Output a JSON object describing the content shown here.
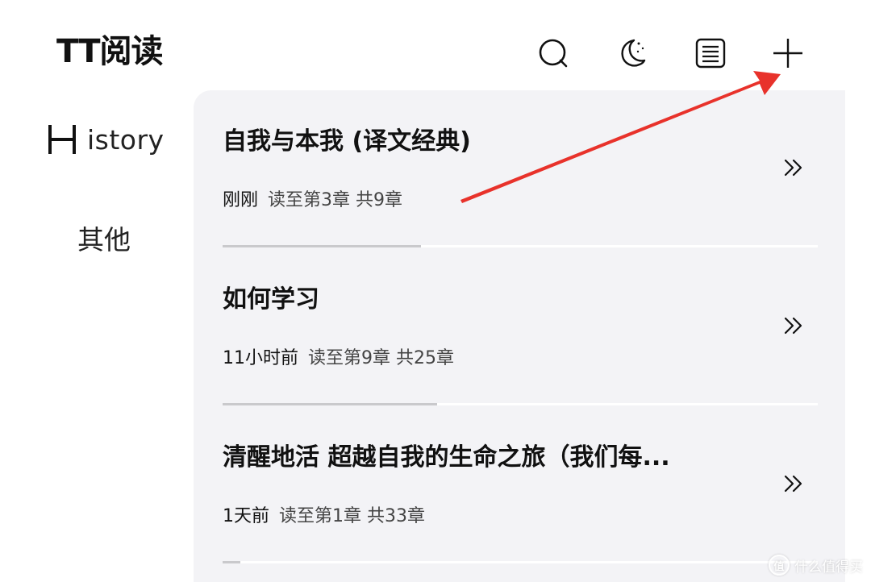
{
  "header": {
    "title": "TT阅读",
    "icons": {
      "search": "search-icon",
      "night": "night-mode-icon",
      "list": "list-icon",
      "add": "add-icon"
    }
  },
  "sidebar": {
    "tabs": [
      {
        "label_initial": "H",
        "label_rest": "istory",
        "active": true
      },
      {
        "label": "其他",
        "active": false
      }
    ]
  },
  "history": {
    "items": [
      {
        "title": "自我与本我 (译文经典)",
        "time": "刚刚",
        "progress_text": "读至第3章 共9章",
        "current_chapter": 3,
        "total_chapters": 9
      },
      {
        "title": "如何学习",
        "time": "11小时前",
        "progress_text": "读至第9章 共25章",
        "current_chapter": 9,
        "total_chapters": 25
      },
      {
        "title": "清醒地活 超越自我的生命之旅（我们每...",
        "time": "1天前",
        "progress_text": "读至第1章 共33章",
        "current_chapter": 1,
        "total_chapters": 33
      }
    ],
    "open_icon": "double-chevron-right-icon"
  },
  "annotation": {
    "arrow_color": "#e8322b"
  },
  "watermark": {
    "icon_text": "值",
    "text": "什么值得买"
  },
  "colors": {
    "panel_bg": "#f3f3f6",
    "progress": "#c9c9cc",
    "text": "#111111"
  }
}
